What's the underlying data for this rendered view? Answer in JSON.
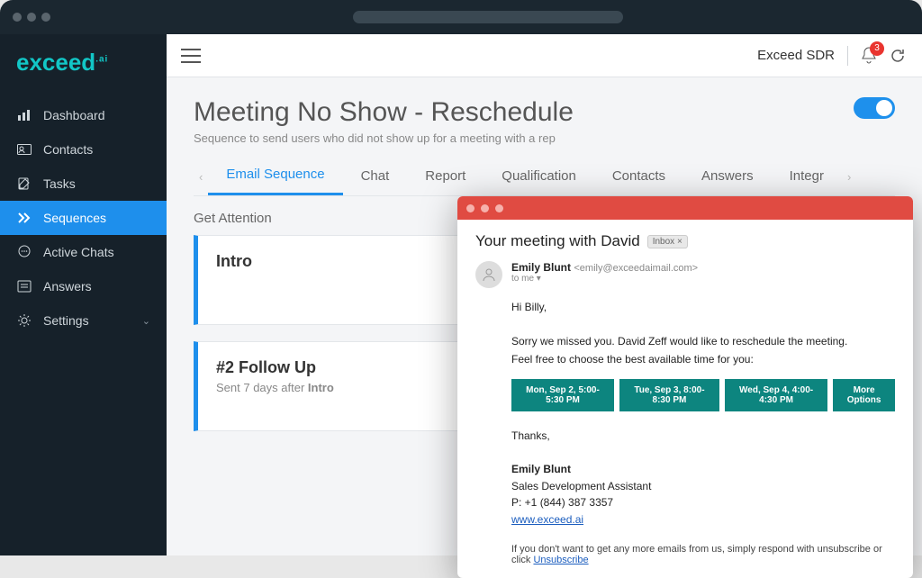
{
  "header": {
    "user_label": "Exceed SDR",
    "notification_count": "3"
  },
  "logo": {
    "main": "exceed",
    "suffix": ".ai"
  },
  "sidebar": {
    "items": [
      {
        "label": "Dashboard",
        "icon": "chart-bar-icon"
      },
      {
        "label": "Contacts",
        "icon": "address-card-icon"
      },
      {
        "label": "Tasks",
        "icon": "edit-icon"
      },
      {
        "label": "Sequences",
        "icon": "chevrons-right-icon",
        "active": true
      },
      {
        "label": "Active Chats",
        "icon": "chat-icon"
      },
      {
        "label": "Answers",
        "icon": "list-icon"
      },
      {
        "label": "Settings",
        "icon": "gear-icon",
        "expandable": true
      }
    ]
  },
  "page": {
    "title": "Meeting No Show - Reschedule",
    "subtitle": "Sequence to send users who did not show up for a meeting with a rep",
    "toggle_on": true
  },
  "tabs": {
    "items": [
      "Email Sequence",
      "Chat",
      "Report",
      "Qualification",
      "Contacts",
      "Answers",
      "Integr"
    ],
    "active_index": 0
  },
  "sequence_section_label": "Get Attention",
  "cards": [
    {
      "title": "Intro",
      "sub": ""
    },
    {
      "title": "#2 Follow Up",
      "sub_prefix": "Sent 7 days after ",
      "sub_bold": "Intro"
    }
  ],
  "email": {
    "subject": "Your meeting with David",
    "inbox_label": "Inbox ×",
    "from_name": "Emily Blunt",
    "from_addr": "<emily@exceedaimail.com>",
    "to_line": "to me ▾",
    "greeting": "Hi Billy,",
    "body_line1": "Sorry we missed you. David Zeff would like to reschedule the meeting.",
    "body_line2": "Feel free to choose the best available time for you:",
    "slots": [
      "Mon, Sep 2, 5:00-5:30 PM",
      "Tue, Sep 3, 8:00-8:30 PM",
      "Wed, Sep 4, 4:00-4:30 PM",
      "More Options"
    ],
    "closing": "Thanks,",
    "sig_name": "Emily Blunt",
    "sig_title": "Sales Development Assistant",
    "sig_phone": "P: +1 (844) 387 3357",
    "sig_link": "www.exceed.ai",
    "unsub_pre": "If you don't want to get any more emails from us, simply respond with unsubscribe or click ",
    "unsub_link": "Unsubscribe"
  }
}
